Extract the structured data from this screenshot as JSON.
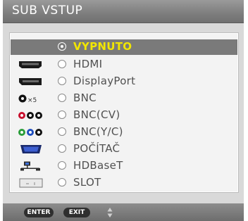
{
  "title": "SUB VSTUP",
  "items": [
    {
      "icon": "none",
      "label": "VYPNUTO",
      "selected": true
    },
    {
      "icon": "hdmi-icon",
      "label": "HDMI",
      "selected": false
    },
    {
      "icon": "displayport-icon",
      "label": "DisplayPort",
      "selected": false
    },
    {
      "icon": "bnc-x5-icon",
      "label": "BNC",
      "selected": false,
      "icon_text": "×5"
    },
    {
      "icon": "bnc-cv-icon",
      "label": "BNC(CV)",
      "selected": false
    },
    {
      "icon": "bnc-yc-icon",
      "label": "BNC(Y/C)",
      "selected": false
    },
    {
      "icon": "computer-vga-icon",
      "label": "POČÍTAČ",
      "selected": false
    },
    {
      "icon": "network-icon",
      "label": "HDBaseT",
      "selected": false
    },
    {
      "icon": "slot-icon",
      "label": "SLOT",
      "selected": false
    }
  ],
  "footer": {
    "enter_label": "ENTER",
    "exit_label": "EXIT",
    "nav_icon": "up-down-arrows-icon"
  },
  "colors": {
    "selected_bg": "#7a7a7a",
    "selected_text": "#f2e600",
    "text": "#505050"
  }
}
